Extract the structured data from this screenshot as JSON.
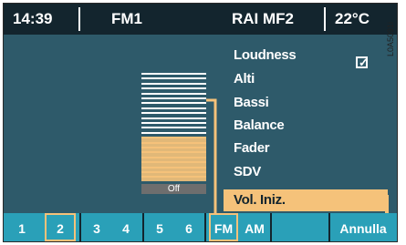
{
  "status_bar": {
    "time": "14:39",
    "band": "FM1",
    "station": "RAI MF2",
    "temperature": "22°C"
  },
  "side_code": "L0A5091i",
  "menu": {
    "items": [
      {
        "label": "Loudness",
        "checked": true
      },
      {
        "label": "Alti"
      },
      {
        "label": "Bassi"
      },
      {
        "label": "Balance"
      },
      {
        "label": "Fader"
      },
      {
        "label": "SDV"
      },
      {
        "label": "Vol. Iniz.",
        "selected": true
      }
    ]
  },
  "volume_bar": {
    "off_label": "Off",
    "level_fraction": 0.4
  },
  "bottom_bar": {
    "presets": [
      "1",
      "2",
      "3",
      "4",
      "5",
      "6"
    ],
    "selected_preset": "2",
    "bands": [
      "FM",
      "AM"
    ],
    "selected_band": "FM",
    "cancel_label": "Annulla"
  },
  "colors": {
    "background": "#2e5a6a",
    "status_bar": "#13252e",
    "bottom_bar": "#2aa0b8",
    "highlight": "#f5c27a"
  }
}
